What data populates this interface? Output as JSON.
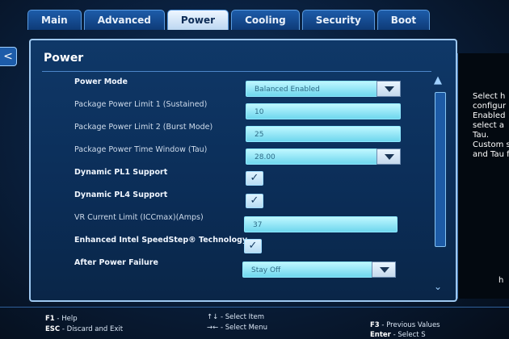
{
  "tabs": [
    "Main",
    "Advanced",
    "Power",
    "Cooling",
    "Security",
    "Boot"
  ],
  "active_tab": "Power",
  "back_label": "<",
  "panel_title": "Power",
  "settings": {
    "power_mode": {
      "label": "Power Mode",
      "value": "Balanced Enabled"
    },
    "pl1": {
      "label": "Package Power Limit 1 (Sustained)",
      "value": "10"
    },
    "pl2": {
      "label": "Package Power Limit 2 (Burst Mode)",
      "value": "25"
    },
    "tau": {
      "label": "Package Power Time Window (Tau)",
      "value": "28.00"
    },
    "dyn_pl1": {
      "label": "Dynamic PL1 Support",
      "checked": "✓"
    },
    "dyn_pl4": {
      "label": "Dynamic PL4 Support",
      "checked": "✓"
    },
    "vr_current": {
      "label": "VR Current Limit (ICCmax)(Amps)",
      "value": "37"
    },
    "speedstep": {
      "label": "Enhanced Intel SpeedStep® Technology",
      "checked": "✓"
    },
    "after_power": {
      "label": "After Power Failure",
      "value": "Stay Off"
    }
  },
  "help_text": "Select h\nconfigur\nEnabled\nselect a\nTau.\nCustom s\nand Tau f",
  "help_bottom": "h",
  "footer": {
    "f1": {
      "key": "F1",
      "text": " - Help"
    },
    "esc": {
      "key": "ESC",
      "text": " - Discard and Exit"
    },
    "select_item": "↑↓ - Select Item",
    "select_menu": "→← - Select Menu",
    "f3": {
      "key": "F3",
      "text": " - Previous Values"
    },
    "enter": {
      "key": "Enter",
      "text": " - Select S"
    }
  }
}
